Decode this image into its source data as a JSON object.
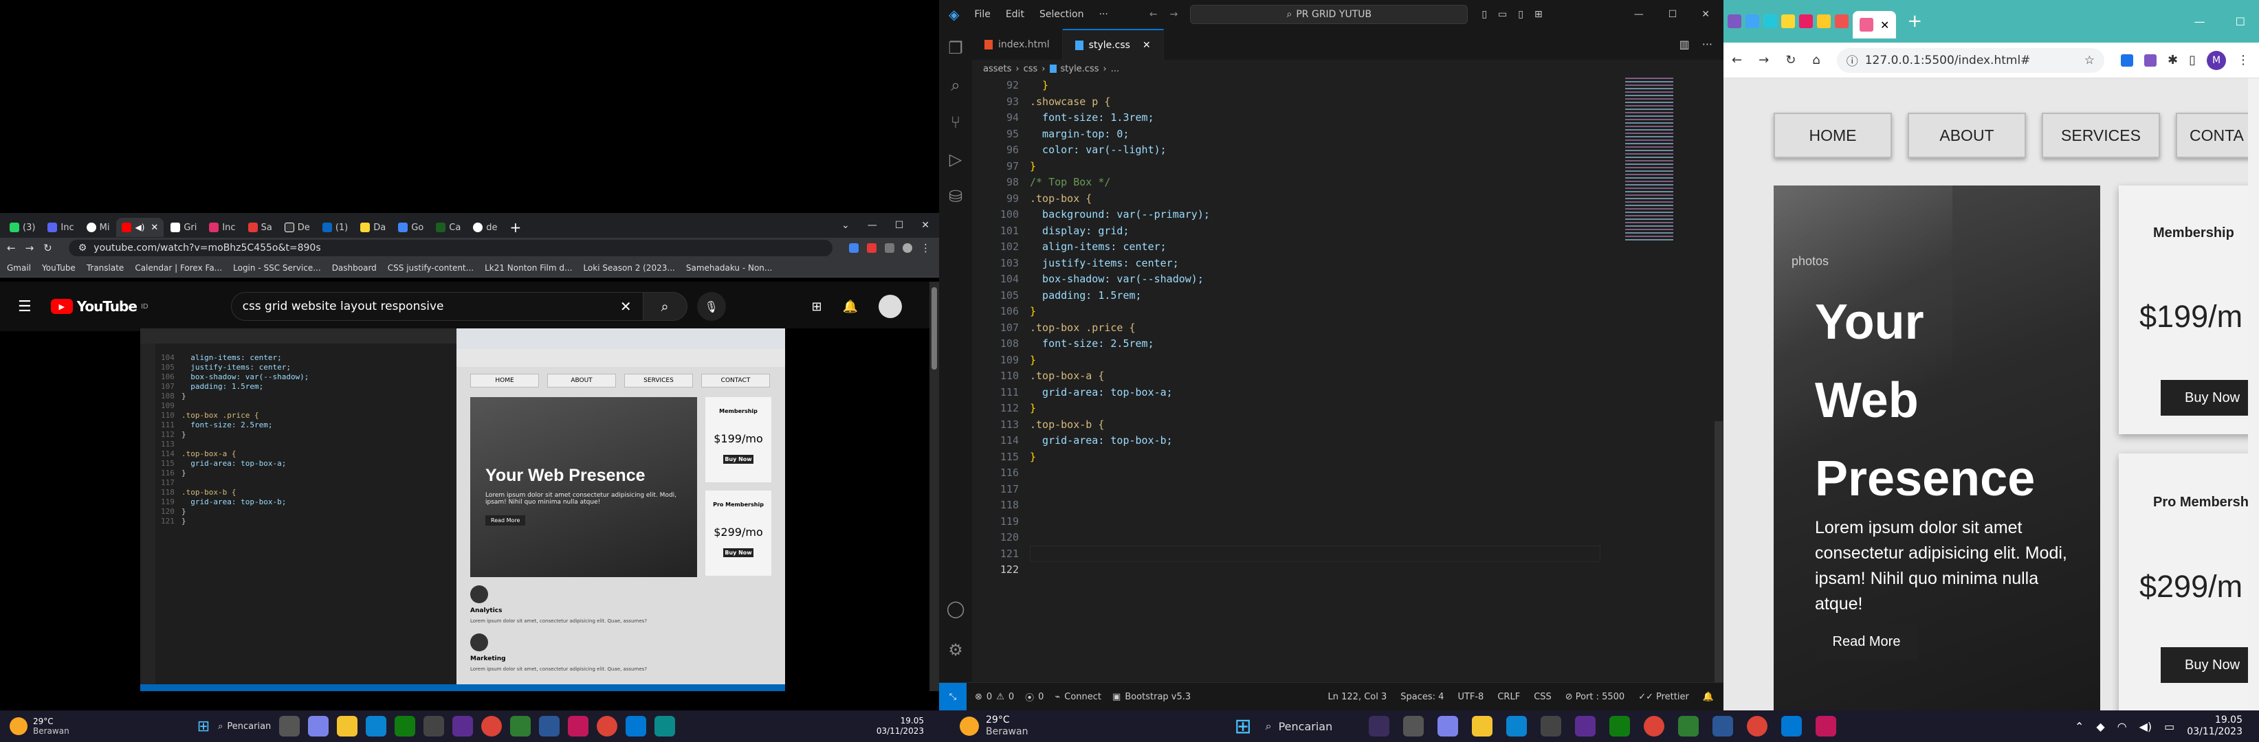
{
  "left_browser": {
    "tabs": [
      "(3)",
      "Inc",
      "Mi",
      "",
      "Gri",
      "Inc",
      "Sa",
      "De",
      "(1)",
      "Da",
      "Go",
      "Ca",
      "de"
    ],
    "url": "youtube.com/watch?v=moBhz5C455o&t=890s",
    "bookmarks": [
      "Gmail",
      "YouTube",
      "Translate",
      "Calendar | Forex Fa...",
      "Login - SSC Service...",
      "Dashboard",
      "CSS justify-content...",
      "Lk21 Nonton Film d...",
      "Loki Season 2 (2023...",
      "Samehadaku - Non..."
    ],
    "youtube": {
      "logo": "YouTube",
      "logo_sup": "ID",
      "search_value": "css grid website layout responsive"
    },
    "video": {
      "code_lines": [
        {
          "n": "104",
          "t": "  align-items: center;"
        },
        {
          "n": "105",
          "t": "  justify-items: center;"
        },
        {
          "n": "106",
          "t": "  box-shadow: var(--shadow);"
        },
        {
          "n": "107",
          "t": "  padding: 1.5rem;"
        },
        {
          "n": "108",
          "t": "}"
        },
        {
          "n": "109",
          "t": ""
        },
        {
          "n": "110",
          "t": ".top-box .price {"
        },
        {
          "n": "111",
          "t": "  font-size: 2.5rem;"
        },
        {
          "n": "112",
          "t": "}"
        },
        {
          "n": "113",
          "t": ""
        },
        {
          "n": "114",
          "t": ".top-box-a {"
        },
        {
          "n": "115",
          "t": "  grid-area: top-box-a;"
        },
        {
          "n": "116",
          "t": "}"
        },
        {
          "n": "117",
          "t": ""
        },
        {
          "n": "118",
          "t": ".top-box-b {"
        },
        {
          "n": "119",
          "t": "  grid-area: top-box-b;"
        },
        {
          "n": "120",
          "t": "}"
        },
        {
          "n": "121",
          "t": "}"
        }
      ],
      "nav": [
        "HOME",
        "ABOUT",
        "SERVICES",
        "CONTACT"
      ],
      "hero_title": "Your Web Presence",
      "hero_text": "Lorem ipsum dolor sit amet consectetur adipisicing elit. Modi, ipsam! Nihil quo minima nulla atque!",
      "hero_btn": "Read More",
      "box_a": {
        "title": "Membership",
        "price": "$199/mo",
        "btn": "Buy Now"
      },
      "box_b": {
        "title": "Pro Membership",
        "price": "$299/mo",
        "btn": "Buy Now"
      },
      "feature_1": "Analytics",
      "feature_2": "Marketing",
      "feature_text": "Lorem ipsum dolor sit amet, consectetur adipisicing elit. Quae, assumes?"
    }
  },
  "taskbar_left": {
    "weather_temp": "29°C",
    "weather_desc": "Berawan",
    "search": "Pencarian",
    "time": "19.05",
    "date": "03/11/2023"
  },
  "taskbar_right": {
    "weather_temp": "29°C",
    "weather_desc": "Berawan",
    "search": "Pencarian",
    "time": "19.05",
    "date": "03/11/2023"
  },
  "vscode": {
    "menu": [
      "File",
      "Edit",
      "Selection",
      "···"
    ],
    "search": "PR GRID YUTUB",
    "tabs": [
      {
        "label": "index.html",
        "icon_color": "#e44d26"
      },
      {
        "label": "style.css",
        "icon_color": "#42a5f5"
      }
    ],
    "breadcrumb": [
      "assets",
      "css",
      "style.css",
      "..."
    ],
    "lines": [
      {
        "n": "92",
        "t": "  }"
      },
      {
        "n": "93",
        "t": ""
      },
      {
        "n": "94",
        "t": ".showcase p {"
      },
      {
        "n": "95",
        "t": "  font-size: 1.3rem;"
      },
      {
        "n": "96",
        "t": "  margin-top: 0;"
      },
      {
        "n": "97",
        "t": "  color: var(--light);"
      },
      {
        "n": "98",
        "t": "}"
      },
      {
        "n": "99",
        "t": ""
      },
      {
        "n": "100",
        "t": "/* Top Box */"
      },
      {
        "n": "101",
        "t": ".top-box {"
      },
      {
        "n": "102",
        "t": "  background: var(--primary);"
      },
      {
        "n": "103",
        "t": "  display: grid;"
      },
      {
        "n": "104",
        "t": "  align-items: center;"
      },
      {
        "n": "105",
        "t": "  justify-items: center;"
      },
      {
        "n": "106",
        "t": "  box-shadow: var(--shadow);"
      },
      {
        "n": "107",
        "t": "  padding: 1.5rem;"
      },
      {
        "n": "108",
        "t": "}"
      },
      {
        "n": "109",
        "t": ""
      },
      {
        "n": "110",
        "t": ".top-box .price {"
      },
      {
        "n": "111",
        "t": "  font-size: 2.5rem;"
      },
      {
        "n": "112",
        "t": "}"
      },
      {
        "n": "113",
        "t": ""
      },
      {
        "n": "114",
        "t": ".top-box-a {"
      },
      {
        "n": "115",
        "t": "  grid-area: top-box-a;"
      },
      {
        "n": "116",
        "t": "}"
      },
      {
        "n": "117",
        "t": ""
      },
      {
        "n": "118",
        "t": ".top-box-b {"
      },
      {
        "n": "119",
        "t": "  grid-area: top-box-b;"
      },
      {
        "n": "120",
        "t": "}"
      },
      {
        "n": "121",
        "t": ""
      },
      {
        "n": "122",
        "t": ""
      }
    ],
    "status": {
      "errors": "0",
      "warnings": "0",
      "ports": "0",
      "connect": "Connect",
      "bootstrap": "Bootstrap v5.3",
      "position": "Ln 122, Col 3",
      "spaces": "Spaces: 4",
      "encoding": "UTF-8",
      "eol": "CRLF",
      "lang": "CSS",
      "port": "Port : 5500",
      "prettier": "Prettier"
    }
  },
  "right_browser": {
    "url": "127.0.0.1:5500/index.html#",
    "avatar": "M",
    "nav": [
      "HOME",
      "ABOUT",
      "SERVICES",
      "CONTA"
    ],
    "hero_title_1": "Your",
    "hero_title_2": "Web",
    "hero_title_3": "Presence",
    "hero_text": "Lorem ipsum dolor sit amet consectetur adipisicing elit. Modi, ipsam! Nihil quo minima nulla atque!",
    "hero_btn": "Read More",
    "hero_img_text": "photos",
    "box_a": {
      "title": "Membership",
      "price": "$199/m",
      "btn": "Buy Now"
    },
    "box_b": {
      "title": "Pro Membersh",
      "price": "$299/m",
      "btn": "Buy Now"
    }
  }
}
